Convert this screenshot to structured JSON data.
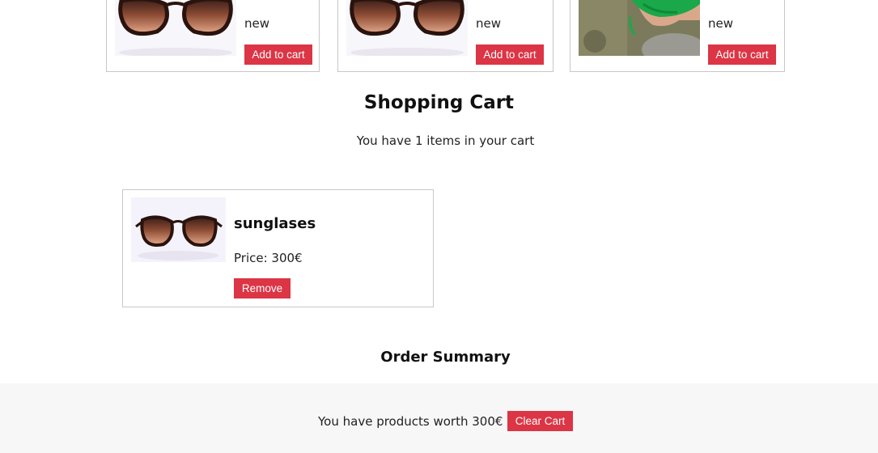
{
  "products": [
    {
      "image": "sunglasses",
      "status": "new",
      "button_label": "Add to cart"
    },
    {
      "image": "sunglasses",
      "status": "new",
      "button_label": "Add to cart"
    },
    {
      "image": "child-green-hat",
      "status": "new",
      "button_label": "Add to cart"
    }
  ],
  "cart": {
    "title": "Shopping Cart",
    "count_text": "You have 1 items in your cart",
    "items": [
      {
        "name": "sunglases",
        "price_text": "Price: 300€",
        "remove_label": "Remove",
        "image": "sunglasses"
      }
    ]
  },
  "summary": {
    "title": "Order Summary",
    "worth_text": "You have products worth 300€",
    "clear_label": "Clear Cart"
  },
  "colors": {
    "accent": "#dc3545",
    "card_border": "#c8c8c8",
    "summary_bg": "#f7f7f7"
  }
}
